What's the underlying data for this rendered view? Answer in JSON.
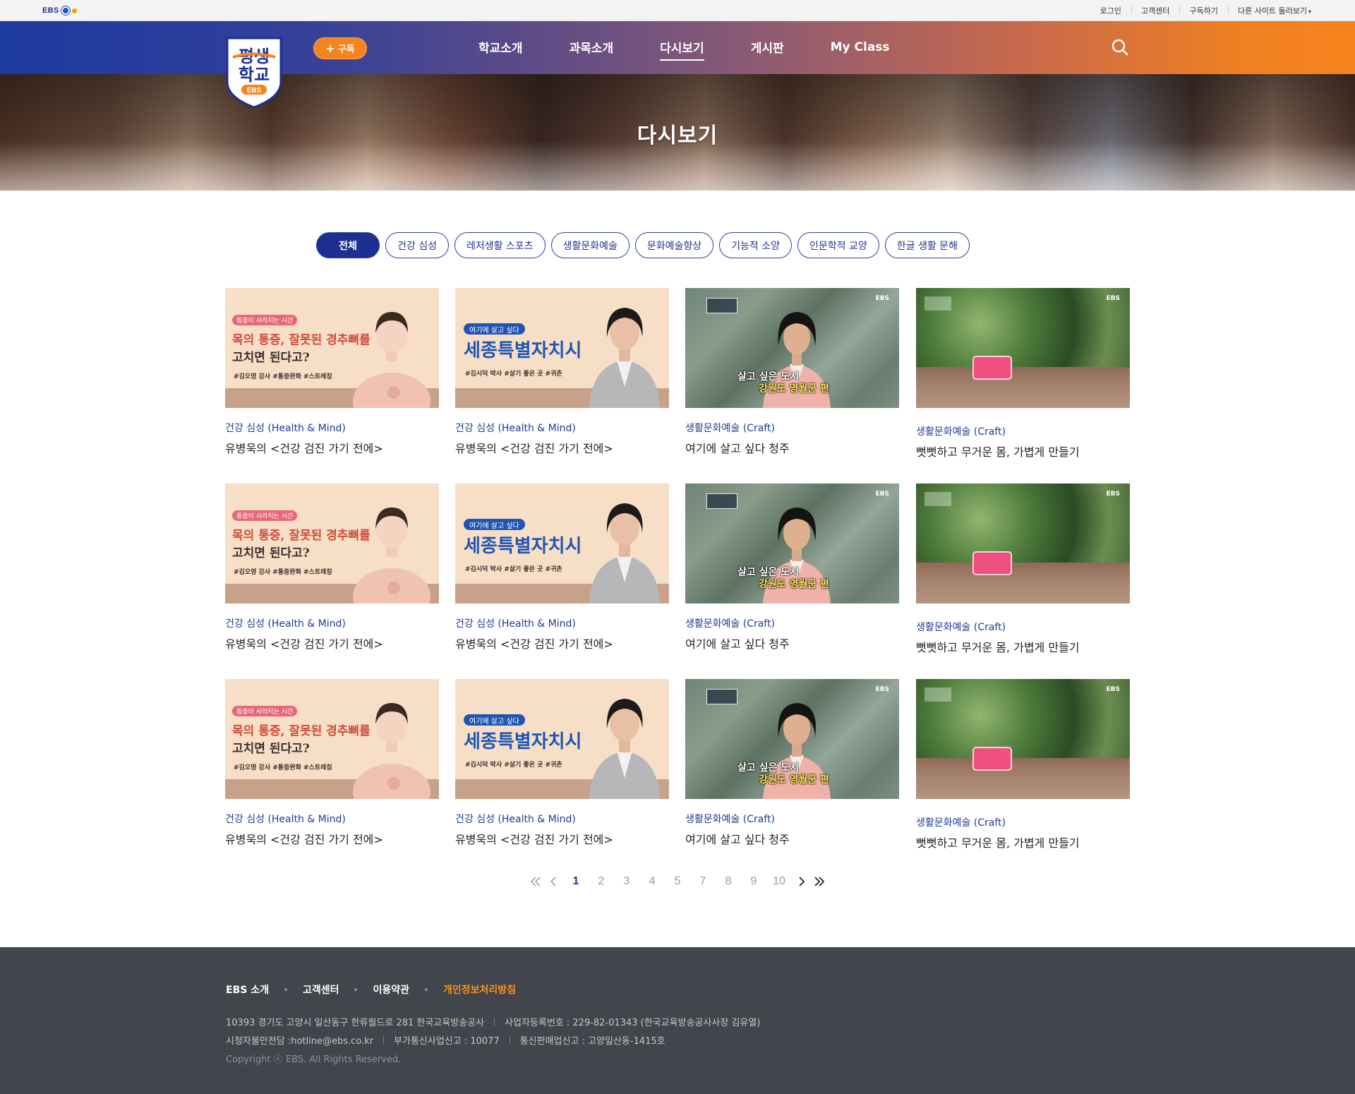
{
  "utility": {
    "logo": "EBS",
    "links": [
      "로그인",
      "고객센터",
      "구독하기",
      "다른 사이트 둘러보기"
    ]
  },
  "header": {
    "brand_line1": "평생",
    "brand_line2": "학교",
    "brand_badge": "EBS",
    "subscribe_label": "구독",
    "nav": [
      "학교소개",
      "과목소개",
      "다시보기",
      "게시판",
      "My Class"
    ],
    "active_nav": "다시보기"
  },
  "hero": {
    "title": "다시보기"
  },
  "filters": [
    "전체",
    "건강 심성",
    "레저생활 스포츠",
    "생활문화예술",
    "문화예술향상",
    "기능적 소양",
    "인문학적 교양",
    "한글 생활 문해"
  ],
  "thumbs": {
    "a": {
      "tag": "통증이 사라지는 시간",
      "line1": "목의 통증, 잘못된 경추뼈를",
      "line2": "고치면 된다고?",
      "tags": "#김오영 강사  #통증완화  #스트레칭"
    },
    "b": {
      "tag": "여기에 살고 싶다",
      "title": "세종특별자치시",
      "tags": "#김시덕 박사  #살기 좋은 곳  #귀촌"
    },
    "c": {
      "line1": "살고 싶은 도시",
      "line2": "강원도 영월군 편",
      "ebs": "EBS"
    },
    "d": {
      "ebs": "EBS"
    }
  },
  "cards": [
    {
      "category": "건강 심성 (Health & Mind)",
      "title": "유병욱의 <건강 검진 가기 전에>"
    },
    {
      "category": "건강 심성 (Health & Mind)",
      "title": "유병욱의 <건강 검진 가기 전에>"
    },
    {
      "category": "생활문화예술 (Craft)",
      "title": "여기에 살고 싶다 청주"
    },
    {
      "category": "생활문화예술 (Craft)",
      "title": "뻣뻣하고 무거운 몸, 가볍게 만들기"
    },
    {
      "category": "건강 심성 (Health & Mind)",
      "title": "유병욱의 <건강 검진 가기 전에>"
    },
    {
      "category": "건강 심성 (Health & Mind)",
      "title": "유병욱의 <건강 검진 가기 전에>"
    },
    {
      "category": "생활문화예술 (Craft)",
      "title": "여기에 살고 싶다 청주"
    },
    {
      "category": "생활문화예술 (Craft)",
      "title": "뻣뻣하고 무거운 몸, 가볍게 만들기"
    },
    {
      "category": "건강 심성 (Health & Mind)",
      "title": "유병욱의 <건강 검진 가기 전에>"
    },
    {
      "category": "건강 심성 (Health & Mind)",
      "title": "유병욱의 <건강 검진 가기 전에>"
    },
    {
      "category": "생활문화예술 (Craft)",
      "title": "여기에 살고 싶다 청주"
    },
    {
      "category": "생활문화예술 (Craft)",
      "title": "뻣뻣하고 무거운 몸, 가볍게 만들기"
    }
  ],
  "pagination": {
    "pages": [
      "1",
      "2",
      "3",
      "4",
      "5",
      "7",
      "8",
      "9",
      "10"
    ],
    "current": "1"
  },
  "footer": {
    "links": [
      "EBS 소개",
      "고객센터",
      "이용약관",
      "개인정보처리방침"
    ],
    "address": "10393 경기도 고양시 일산동구 한류월드로 281 한국교육방송공사",
    "business_no": "사업자등록번호 : 229-82-01343 (한국교육방송공사사장 김유열)",
    "hotline": "시청자불만전담 :hotline@ebs.co.kr",
    "vas_no": "부가통신사업신고 : 10077",
    "ecommerce_no": "통신판매업신고 : 고양일산동-1415호",
    "copyright": "Copyright ⓒ EBS. All Rights Reserved."
  },
  "colors": {
    "brand_blue": "#1d3092",
    "brand_orange": "#f7831c",
    "footer_bg": "#43454d",
    "category_text": "#1f3a96"
  }
}
